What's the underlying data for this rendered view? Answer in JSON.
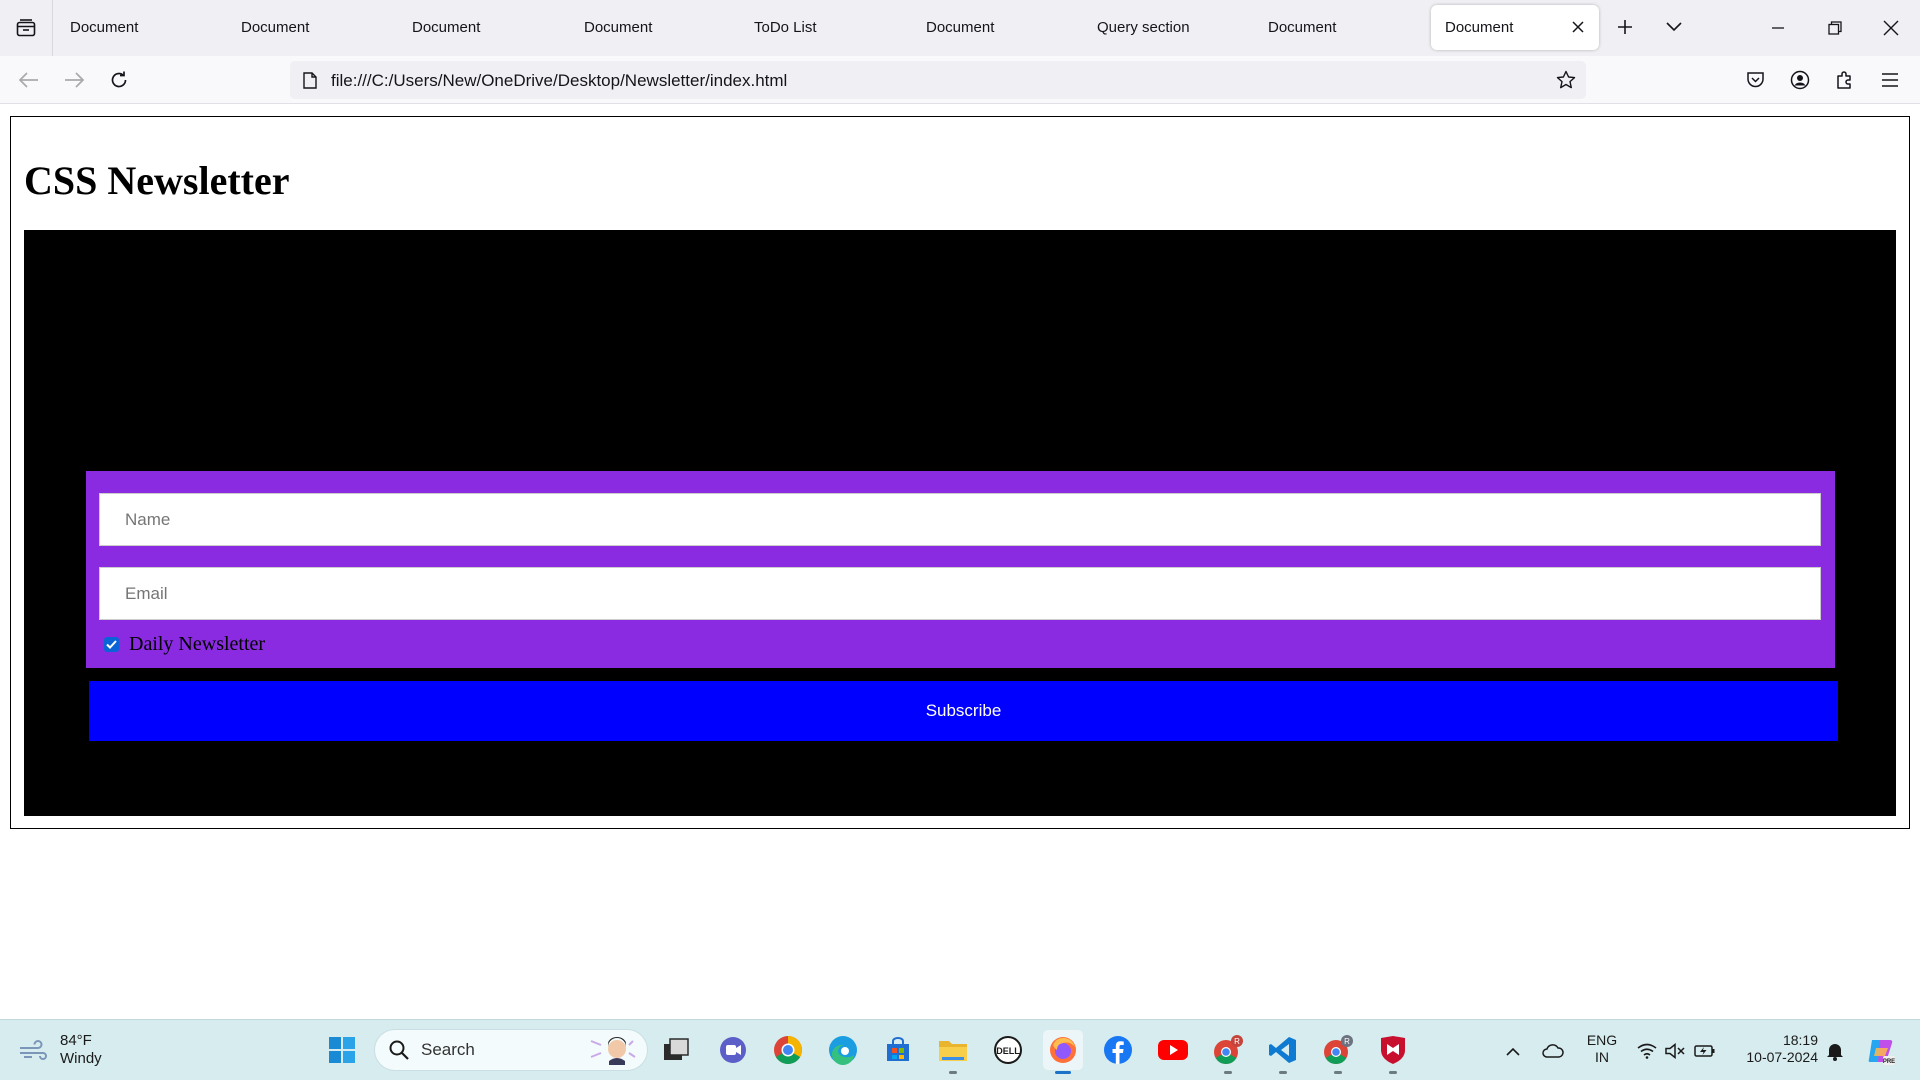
{
  "browser": {
    "tabs": [
      {
        "label": "Document",
        "active": false
      },
      {
        "label": "Document",
        "active": false
      },
      {
        "label": "Document",
        "active": false
      },
      {
        "label": "Document",
        "active": false
      },
      {
        "label": "ToDo List",
        "active": false
      },
      {
        "label": "Document",
        "active": false
      },
      {
        "label": "Query section",
        "active": false
      },
      {
        "label": "Document",
        "active": false
      },
      {
        "label": "Document",
        "active": true
      }
    ],
    "url": "file:///C:/Users/New/OneDrive/Desktop/Newsletter/index.html"
  },
  "page": {
    "title": "CSS Newsletter",
    "form": {
      "name_placeholder": "Name",
      "email_placeholder": "Email",
      "checkbox_label": "Daily Newsletter",
      "checkbox_checked": true,
      "subscribe_label": "Subscribe"
    },
    "colors": {
      "box_background": "#000000",
      "form_panel": "#8a2be2",
      "subscribe_button": "#0000ff"
    }
  },
  "taskbar": {
    "weather_temp": "84°F",
    "weather_desc": "Windy",
    "search_label": "Search",
    "language_primary": "ENG",
    "language_secondary": "IN",
    "time": "18:19",
    "date": "10-07-2024",
    "apps": [
      "start-icon",
      "search",
      "task-view-icon",
      "teams-meet-icon",
      "chrome-icon",
      "edge-icon",
      "store-icon",
      "file-explorer-icon",
      "dell-icon",
      "firefox-icon",
      "facebook-icon",
      "youtube-icon",
      "chrome-profile-icon",
      "vscode-icon",
      "chrome-profile-2-icon",
      "mcafee-icon"
    ]
  }
}
